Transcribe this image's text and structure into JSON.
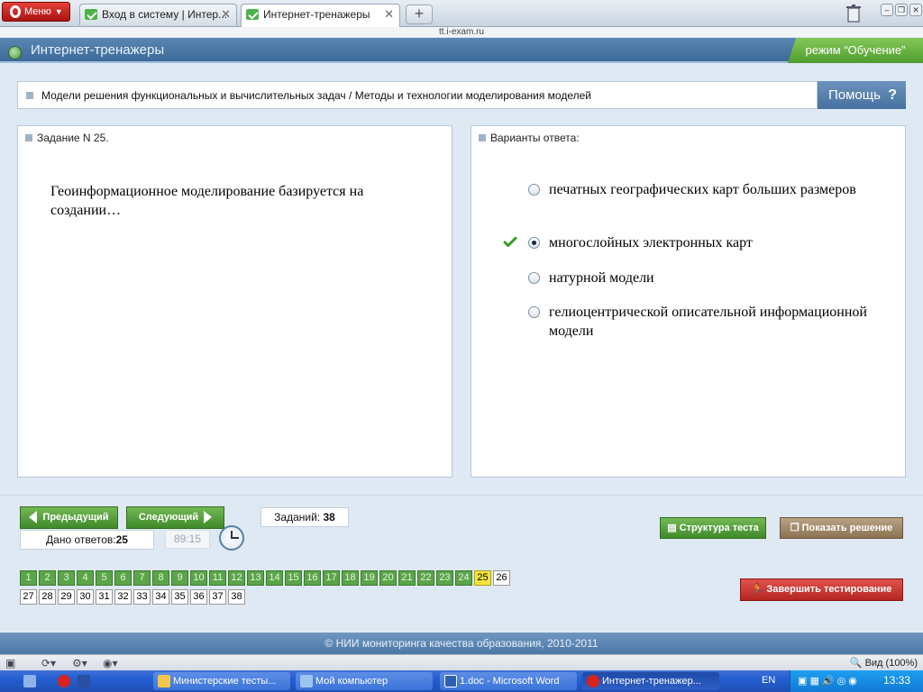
{
  "browser": {
    "menu_label": "Меню",
    "tabs": [
      {
        "label": "Вход в систему | Интер..."
      },
      {
        "label": "Интернет-тренажеры"
      }
    ],
    "url": "tt.i-exam.ru",
    "zoom": "Вид (100%)"
  },
  "header": {
    "title": "Интернет-тренажеры",
    "mode": "режим “Обучение”"
  },
  "breadcrumb": "Модели решения функциональных и вычислительных задач / Методы и технологии моделирования моделей",
  "help_label": "Помощь",
  "help_glyph": "?",
  "task": {
    "heading": "Задание N 25.",
    "question": "Геоинформационное моделирование базируется на создании…"
  },
  "answers": {
    "heading": "Варианты ответа:",
    "options": [
      {
        "text": "печатных географических карт больших размеров",
        "selected": false,
        "correct": false
      },
      {
        "text": "многослойных электронных карт",
        "selected": true,
        "correct": true
      },
      {
        "text": "натурной модели",
        "selected": false,
        "correct": false
      },
      {
        "text": "гелиоцентрической описательной информационной модели",
        "selected": false,
        "correct": false
      }
    ]
  },
  "nav": {
    "prev_label": "Предыдущий",
    "next_label": "Следующий",
    "tasks_label": "Заданий:",
    "tasks_count": "38",
    "answered_label": "Дано ответов:",
    "answered_count": "25",
    "timer": "89:15",
    "structure_label": "Структура теста",
    "solution_label": "Показать решение",
    "finish_label": "Завершить тестирование"
  },
  "task_grid": {
    "total": 38,
    "done_through": 24,
    "current": 25
  },
  "footer": "© НИИ мониторинга качества образования, 2010-2011",
  "taskbar": {
    "items": [
      {
        "label": "Министерские тесты...",
        "active": false
      },
      {
        "label": "Мой компьютер",
        "active": false
      },
      {
        "label": "1.doc - Microsoft Word",
        "active": false
      },
      {
        "label": "Интернет-тренажер...",
        "active": true
      }
    ],
    "lang": "EN",
    "clock": "13:33"
  },
  "colors": {
    "accent_green": "#5aa548",
    "current_yellow": "#f4e43a",
    "header_blue": "#4c78a6",
    "finish_red": "#c43530"
  }
}
